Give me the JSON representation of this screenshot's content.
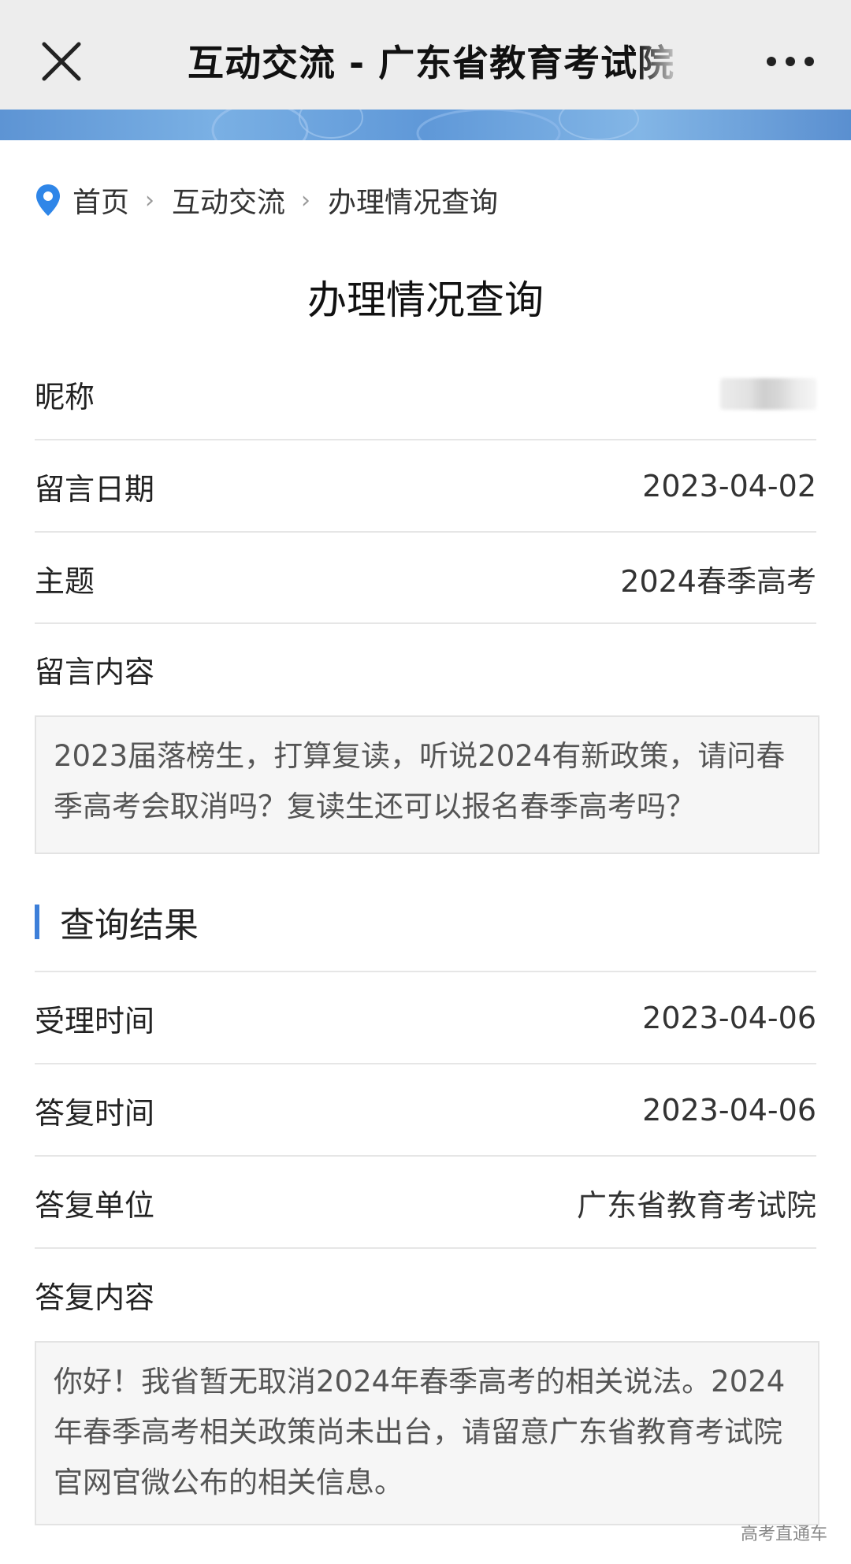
{
  "topbar": {
    "title": "互动交流 - 广东省教育考试院"
  },
  "breadcrumb": {
    "items": [
      "首页",
      "互动交流",
      "办理情况查询"
    ]
  },
  "page_title": "办理情况查询",
  "message": {
    "nickname_label": "昵称",
    "date_label": "留言日期",
    "date_value": "2023-04-02",
    "subject_label": "主题",
    "subject_value": "2024春季高考",
    "content_label": "留言内容",
    "content_text": "2023届落榜生，打算复读，听说2024有新政策，请问春季高考会取消吗？复读生还可以报名春季高考吗？"
  },
  "result": {
    "section_title": "查询结果",
    "accept_time_label": "受理时间",
    "accept_time_value": "2023-04-06",
    "reply_time_label": "答复时间",
    "reply_time_value": "2023-04-06",
    "reply_unit_label": "答复单位",
    "reply_unit_value": "广东省教育考试院",
    "reply_content_label": "答复内容",
    "reply_content_text": "你好！我省暂无取消2024年春季高考的相关说法。2024年春季高考相关政策尚未出台，请留意广东省教育考试院官网官微公布的相关信息。"
  },
  "watermark": "高考直通车",
  "colors": {
    "accent": "#3d7fd9",
    "location_pin": "#2f86e8"
  }
}
